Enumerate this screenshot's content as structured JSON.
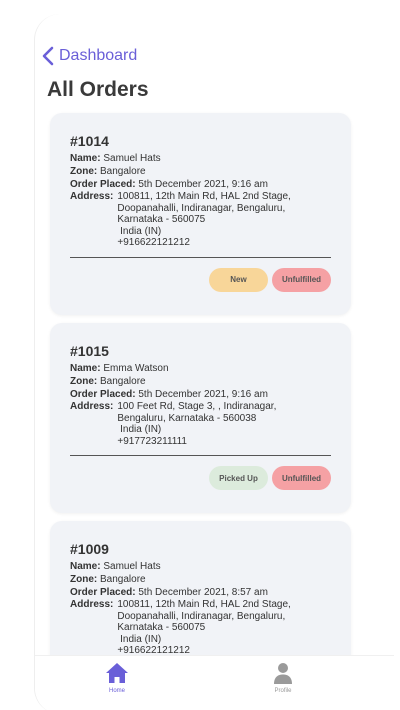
{
  "header": {
    "back_label": "Dashboard",
    "title": "All Orders"
  },
  "labels": {
    "name": "Name:",
    "zone": "Zone:",
    "placed": "Order Placed:",
    "address": "Address:"
  },
  "orders": [
    {
      "id": "#1014",
      "name": "Samuel Hats",
      "zone": "Bangalore",
      "placed": "5th December 2021, 9:16 am",
      "address_lines": [
        "100811, 12th Main Rd, HAL 2nd Stage,",
        "Doopanahalli, Indiranagar, Bengaluru,",
        "Karnataka - 560075",
        " India (IN)",
        "+916622121212"
      ],
      "status": "New",
      "fulfillment": "Unfulfilled"
    },
    {
      "id": "#1015",
      "name": "Emma Watson",
      "zone": "Bangalore",
      "placed": "5th December 2021, 9:16 am",
      "address_lines": [
        "100 Feet Rd, Stage 3, , Indiranagar,",
        "Bengaluru, Karnataka - 560038",
        " India (IN)",
        "+917723211111"
      ],
      "status": "Picked Up",
      "fulfillment": "Unfulfilled"
    },
    {
      "id": "#1009",
      "name": "Samuel Hats",
      "zone": "Bangalore",
      "placed": "5th December 2021, 8:57 am",
      "address_lines": [
        "100811, 12th Main Rd, HAL 2nd Stage,",
        "Doopanahalli, Indiranagar, Bengaluru,",
        "Karnataka - 560075",
        " India (IN)",
        "+916622121212"
      ],
      "status": "",
      "fulfillment": ""
    }
  ],
  "tabbar": {
    "home_label": "Home",
    "profile_label": "Profile"
  },
  "colors": {
    "accent": "#6a5fd8",
    "card_bg": "#f1f3f7",
    "new": "#f8d699",
    "picked": "#dcebdc",
    "unfulfilled": "#f5a1a4"
  }
}
